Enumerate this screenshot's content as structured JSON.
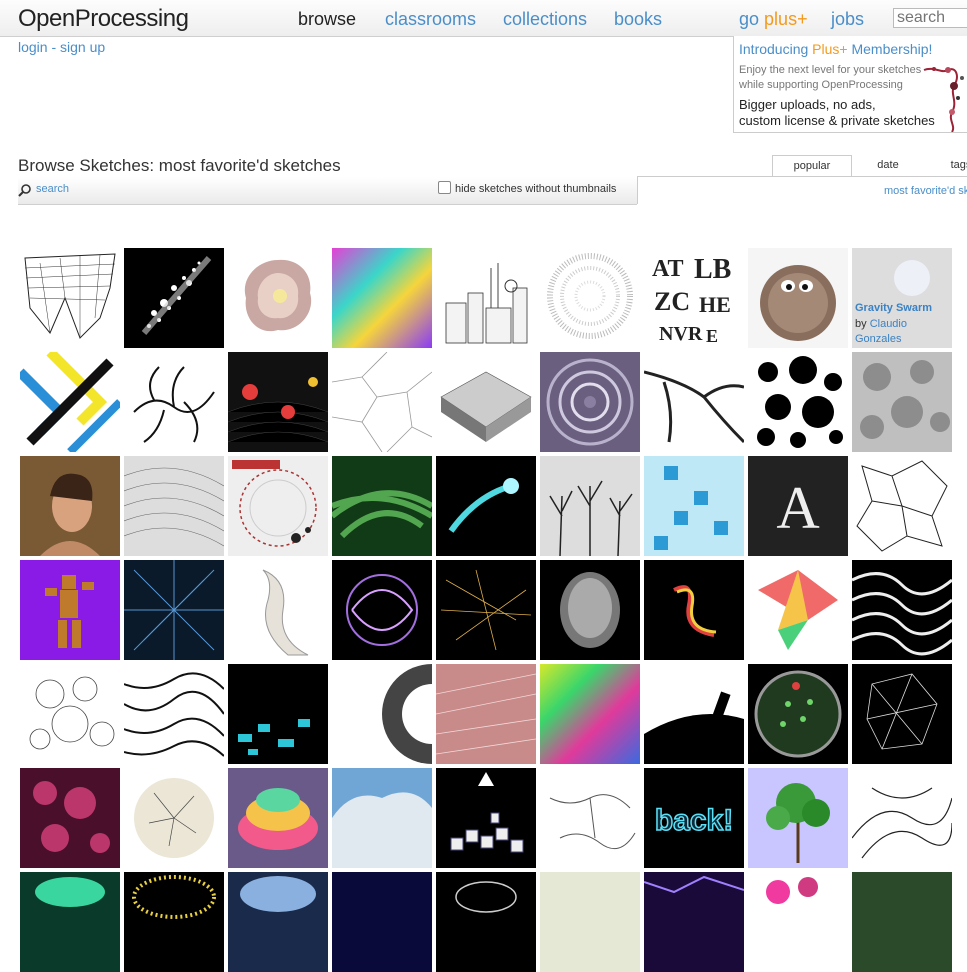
{
  "header": {
    "logo": "OpenProcessing",
    "nav": [
      {
        "label": "browse",
        "active": true
      },
      {
        "label": "classrooms"
      },
      {
        "label": "collections"
      },
      {
        "label": "books"
      }
    ],
    "go_plus": {
      "go": "go",
      "plus": "plus+"
    },
    "jobs": "jobs",
    "search_placeholder": "search",
    "login": "login - sign up"
  },
  "promo": {
    "title_prefix": "Introducing",
    "title_plus": "Plus+",
    "title_suffix": "Membership!",
    "sub1": "Enjoy the next level for your sketches",
    "sub2": "while supporting OpenProcessing",
    "bold1": "Bigger uploads, no ads,",
    "bold2": "custom license & private sketches"
  },
  "browse": {
    "title": "Browse Sketches: most favorite'd sketches",
    "search_link": "search",
    "hide_label": "hide sketches without thumbnails",
    "tabs": [
      "popular",
      "date",
      "tags"
    ],
    "sort_label": "most favorite'd sketches"
  },
  "hover_tile": {
    "title": "Gravity Swarm",
    "by": "by",
    "author": "Claudio Gonzales"
  },
  "colors": {
    "link": "#4a8ec9",
    "accent": "#f39a1e"
  }
}
